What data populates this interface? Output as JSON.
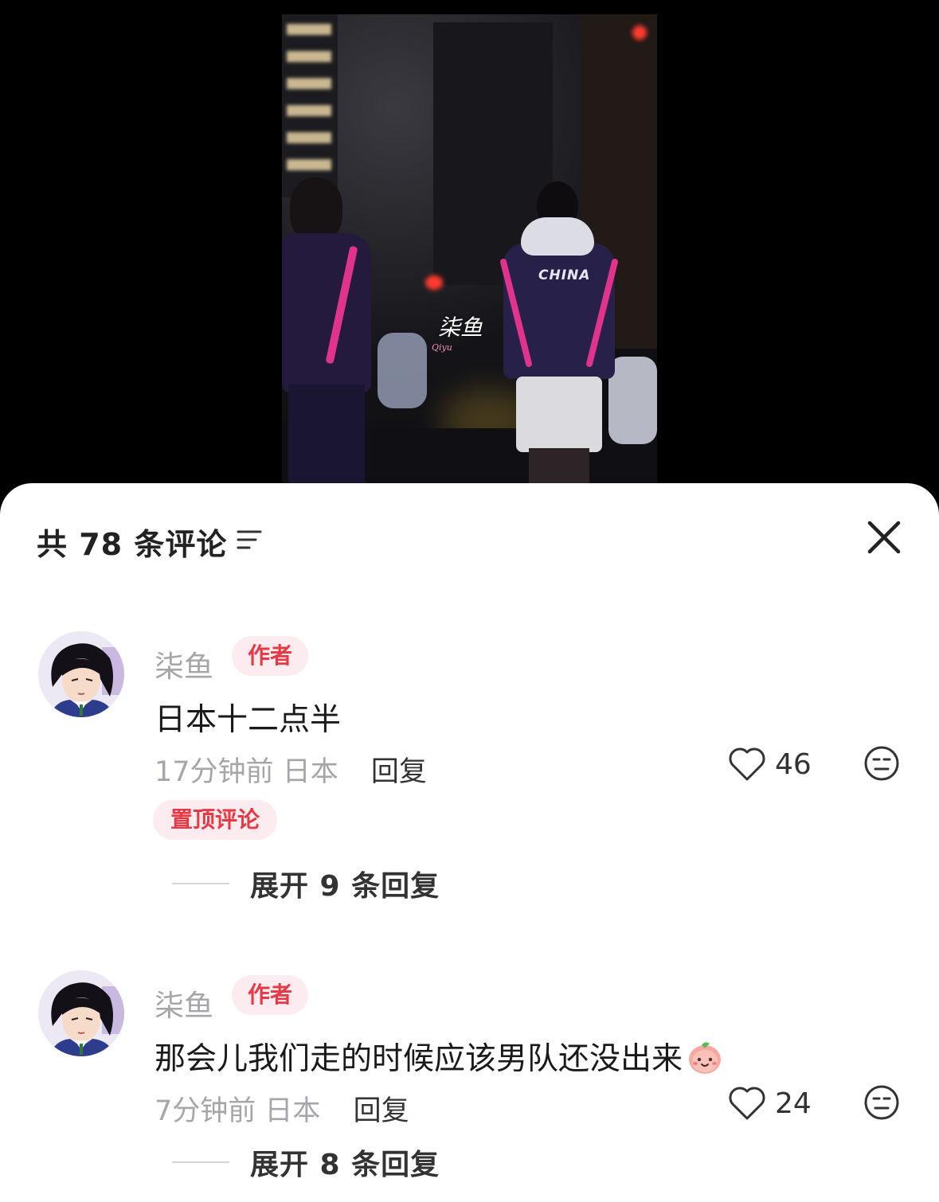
{
  "video": {
    "jersey_text": "CHINA",
    "watermark": "柒鱼",
    "watermark_sub": "Qiyu"
  },
  "comments_panel": {
    "title": "共 78 条评论",
    "sort_icon": "sort-lines-icon",
    "close_icon": "close-x-icon"
  },
  "comments": [
    {
      "author": "柒鱼",
      "badge": "作者",
      "text": "日本十二点半",
      "time": "17分钟前",
      "location": "日本",
      "reply_label": "回复",
      "likes": "46",
      "pinned_label": "置顶评论",
      "expand_label": "展开 9 条回复"
    },
    {
      "author": "柒鱼",
      "badge": "作者",
      "text": "那会儿我们走的时候应该男队还没出来",
      "emoji": "peach-smile-emoji",
      "time": "7分钟前",
      "location": "日本",
      "reply_label": "回复",
      "likes": "24",
      "expand_label": "展开 8 条回复"
    }
  ],
  "colors": {
    "accent_red": "#e63946",
    "badge_bg": "#fdecef",
    "muted_text": "#a6a6aa",
    "jersey": "#272048",
    "stripe_pink": "#e0338c"
  }
}
